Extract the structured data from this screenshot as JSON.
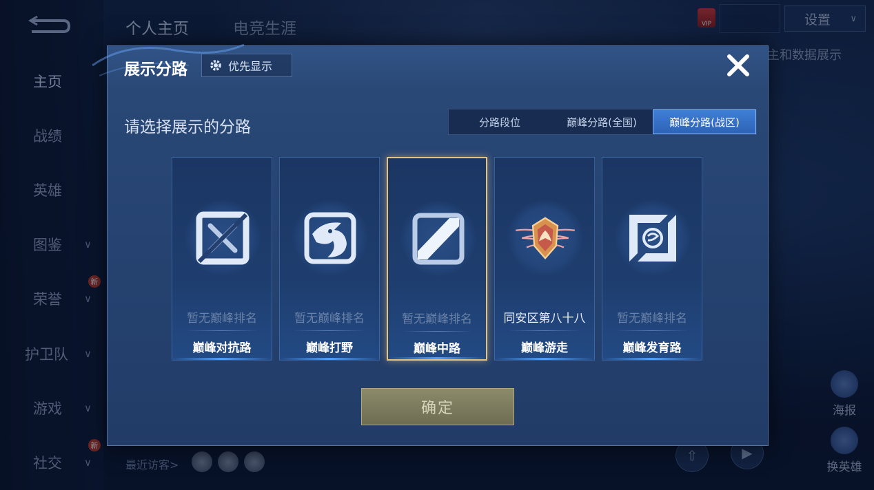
{
  "background": {
    "top_tabs": [
      "个人主页",
      "电竞生涯"
    ],
    "sidebar": [
      {
        "label": "主页",
        "chevron": false,
        "badge": ""
      },
      {
        "label": "战绩",
        "chevron": false,
        "badge": ""
      },
      {
        "label": "英雄",
        "chevron": false,
        "badge": ""
      },
      {
        "label": "图鉴",
        "chevron": true,
        "badge": ""
      },
      {
        "label": "荣誉",
        "chevron": true,
        "badge": "新"
      },
      {
        "label": "护卫队",
        "chevron": true,
        "badge": ""
      },
      {
        "label": "游戏",
        "chevron": true,
        "badge": ""
      },
      {
        "label": "社交",
        "chevron": true,
        "badge": "新"
      }
    ],
    "settings_label": "设置",
    "vip_label": "VIP",
    "data_display_text": "主和数据展示",
    "right_buttons": [
      "海报",
      "换英雄"
    ],
    "recent_visitors": "最近访客>"
  },
  "modal": {
    "title": "展示分路",
    "priority_button": "优先显示",
    "prompt": "请选择展示的分路",
    "tabs": [
      "分路段位",
      "巅峰分路(全国)",
      "巅峰分路(战区)"
    ],
    "active_tab": 2,
    "cards": [
      {
        "rank": "暂无巅峰排名",
        "role": "巅峰对抗路",
        "icon": "clash-lane-icon",
        "selected": false
      },
      {
        "rank": "暂无巅峰排名",
        "role": "巅峰打野",
        "icon": "jungle-dragon-icon",
        "selected": false
      },
      {
        "rank": "暂无巅峰排名",
        "role": "巅峰中路",
        "icon": "mid-lane-icon",
        "selected": true
      },
      {
        "rank": "同安区第八十八",
        "role": "巅峰游走",
        "icon": "winged-shield-icon",
        "selected": false
      },
      {
        "rank": "暂无巅峰排名",
        "role": "巅峰发育路",
        "icon": "farm-lane-icon",
        "selected": false
      }
    ],
    "confirm": "确定"
  },
  "colors": {
    "accent": "#3f7fd6",
    "selected_border": "#e7c27d",
    "confirm_bg": "#7d7c5f"
  }
}
